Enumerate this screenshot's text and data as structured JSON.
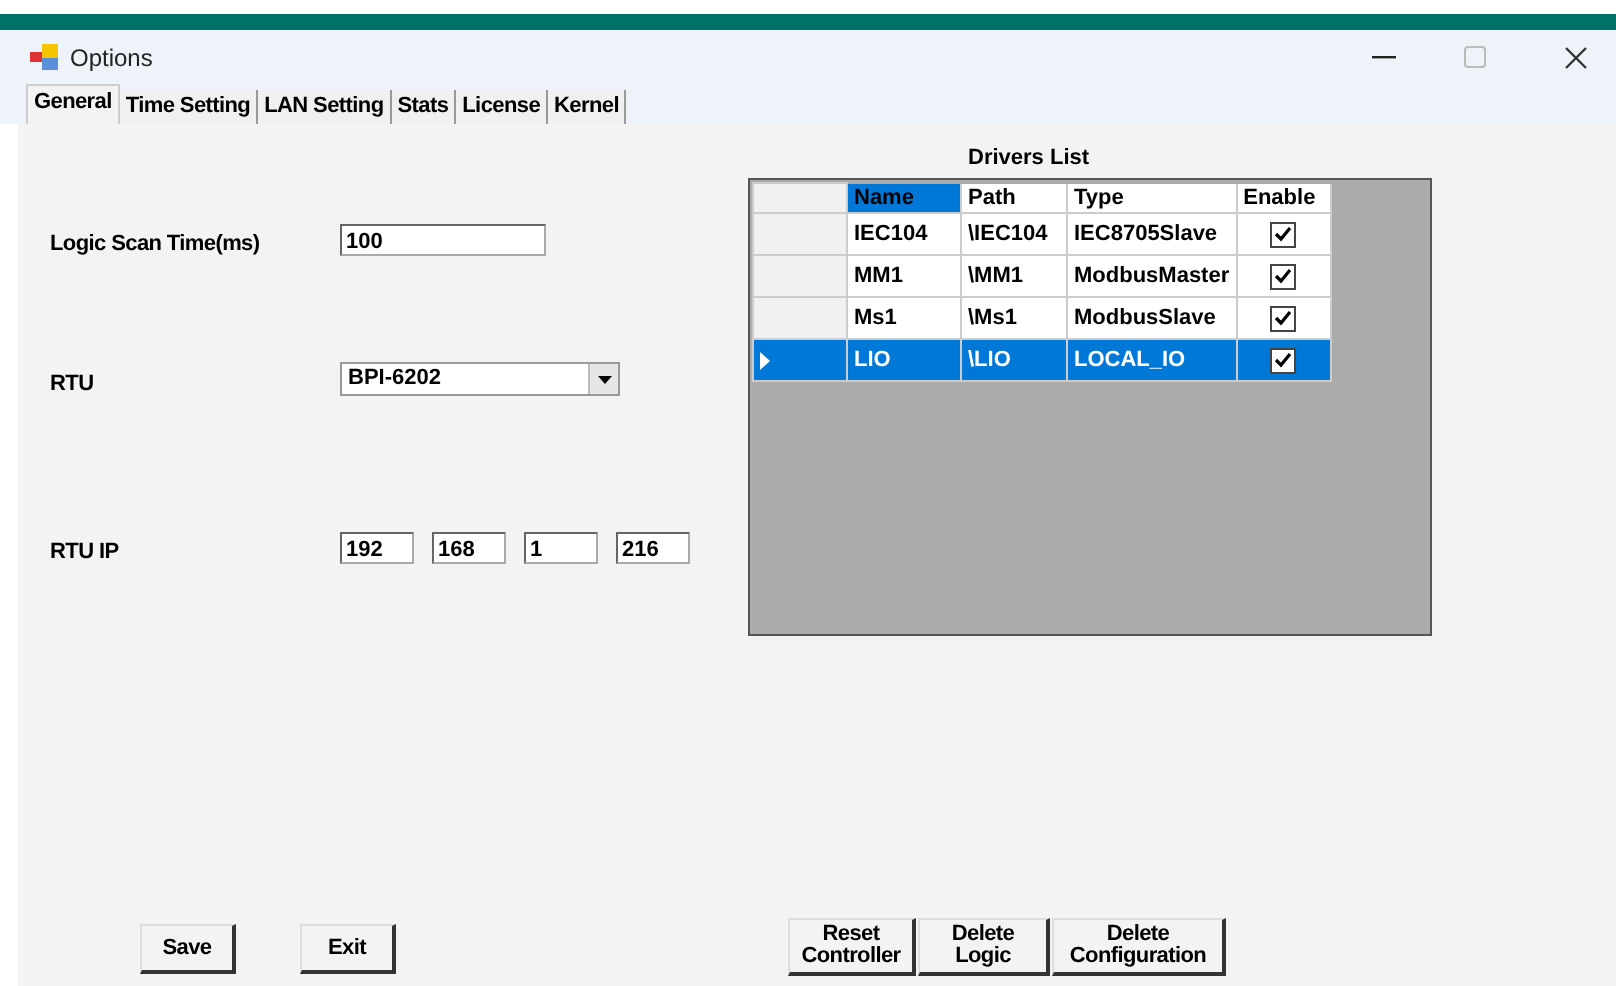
{
  "window": {
    "title": "Options"
  },
  "tabs": [
    {
      "label": "General",
      "selected": true
    },
    {
      "label": "Time Setting",
      "selected": false
    },
    {
      "label": "LAN Setting",
      "selected": false
    },
    {
      "label": "Stats",
      "selected": false
    },
    {
      "label": "License",
      "selected": false
    },
    {
      "label": "Kernel",
      "selected": false
    }
  ],
  "settings": [
    {
      "kind": "text",
      "label": "Logic Scan Time(ms)",
      "value": "100"
    },
    {
      "kind": "combo",
      "label": "RTU",
      "value": "BPI-6202"
    },
    {
      "kind": "ip",
      "label": "RTU IP",
      "parts": [
        "192",
        "168",
        "1",
        "216"
      ]
    }
  ],
  "drivers": {
    "title": "Drivers List",
    "columns": [
      "Name",
      "Path",
      "Type",
      "Enable"
    ],
    "rows": [
      {
        "name": "IEC104",
        "path": "\\IEC104",
        "type": "IEC8705Slave",
        "enable": true,
        "selected": false
      },
      {
        "name": "MM1",
        "path": "\\MM1",
        "type": "ModbusMaster",
        "enable": true,
        "selected": false
      },
      {
        "name": "Ms1",
        "path": "\\Ms1",
        "type": "ModbusSlave",
        "enable": true,
        "selected": false
      },
      {
        "name": "LIO",
        "path": "\\LIO",
        "type": "LOCAL_IO",
        "enable": true,
        "selected": true
      }
    ]
  },
  "left_buttons": [
    "Save",
    "Exit"
  ],
  "right_buttons": [
    "Reset Controller",
    "Delete Logic",
    "Delete Configuration"
  ]
}
